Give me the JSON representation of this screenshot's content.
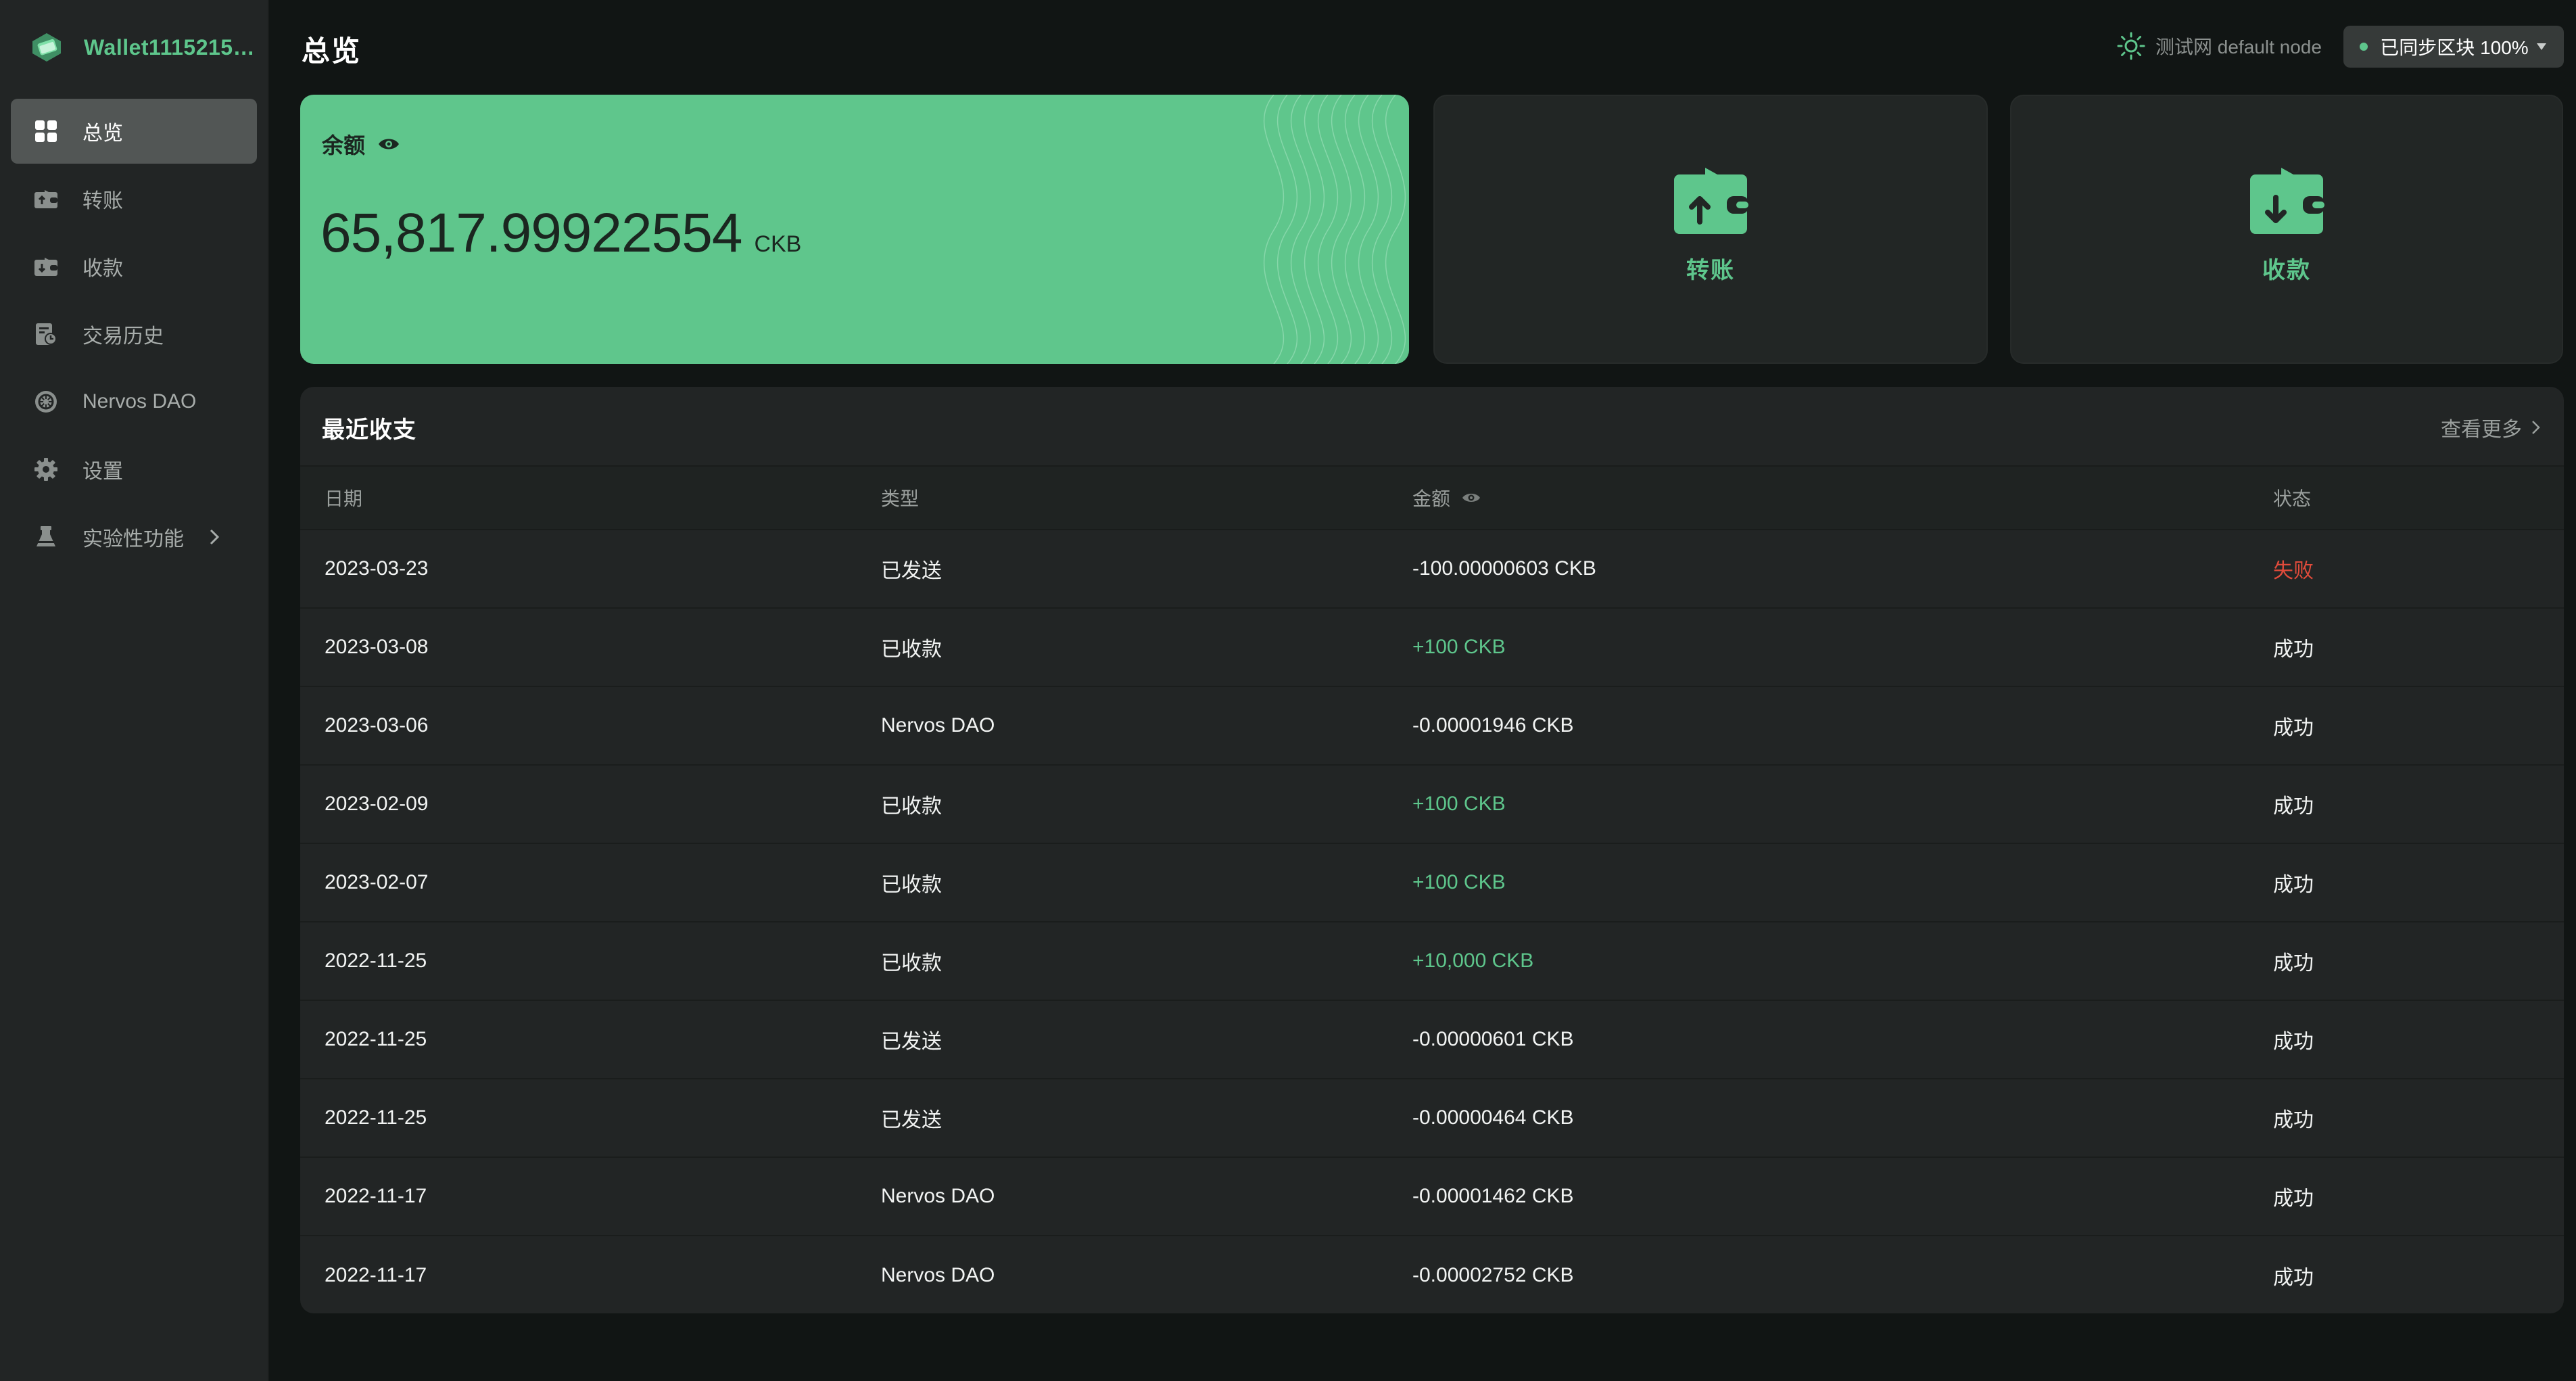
{
  "colors": {
    "accent": "#5ec68c",
    "failed": "#e14b3b",
    "active_nav_bg": "#525655"
  },
  "sidebar": {
    "wallet_name": "Wallet111521515...",
    "items": [
      {
        "label": "总览",
        "icon": "overview-grid-icon",
        "active": true
      },
      {
        "label": "转账",
        "icon": "send-wallet-icon",
        "active": false
      },
      {
        "label": "收款",
        "icon": "receive-wallet-icon",
        "active": false
      },
      {
        "label": "交易历史",
        "icon": "history-icon",
        "active": false
      },
      {
        "label": "Nervos DAO",
        "icon": "dao-icon",
        "active": false
      },
      {
        "label": "设置",
        "icon": "gear-icon",
        "active": false
      },
      {
        "label": "实验性功能",
        "icon": "flask-icon",
        "active": false
      }
    ]
  },
  "header": {
    "title": "总览",
    "network": "测试网 default node",
    "sync": "已同步区块 100%"
  },
  "balance": {
    "label": "余额",
    "amount": "65,817.99922554",
    "unit": "CKB"
  },
  "actions": {
    "send": "转账",
    "receive": "收款"
  },
  "recent": {
    "title": "最近收支",
    "see_more": "查看更多",
    "columns": {
      "date": "日期",
      "type": "类型",
      "amount": "金额",
      "status": "状态"
    },
    "rows": [
      {
        "date": "2023-03-23",
        "type": "已发送",
        "amount": "-100.00000603 CKB",
        "status": "失败",
        "positive": false,
        "failed": true
      },
      {
        "date": "2023-03-08",
        "type": "已收款",
        "amount": "+100 CKB",
        "status": "成功",
        "positive": true,
        "failed": false
      },
      {
        "date": "2023-03-06",
        "type": "Nervos DAO",
        "amount": "-0.00001946 CKB",
        "status": "成功",
        "positive": false,
        "failed": false
      },
      {
        "date": "2023-02-09",
        "type": "已收款",
        "amount": "+100 CKB",
        "status": "成功",
        "positive": true,
        "failed": false
      },
      {
        "date": "2023-02-07",
        "type": "已收款",
        "amount": "+100 CKB",
        "status": "成功",
        "positive": true,
        "failed": false
      },
      {
        "date": "2022-11-25",
        "type": "已收款",
        "amount": "+10,000 CKB",
        "status": "成功",
        "positive": true,
        "failed": false
      },
      {
        "date": "2022-11-25",
        "type": "已发送",
        "amount": "-0.00000601 CKB",
        "status": "成功",
        "positive": false,
        "failed": false
      },
      {
        "date": "2022-11-25",
        "type": "已发送",
        "amount": "-0.00000464 CKB",
        "status": "成功",
        "positive": false,
        "failed": false
      },
      {
        "date": "2022-11-17",
        "type": "Nervos DAO",
        "amount": "-0.00001462 CKB",
        "status": "成功",
        "positive": false,
        "failed": false
      },
      {
        "date": "2022-11-17",
        "type": "Nervos DAO",
        "amount": "-0.00002752 CKB",
        "status": "成功",
        "positive": false,
        "failed": false
      }
    ]
  }
}
